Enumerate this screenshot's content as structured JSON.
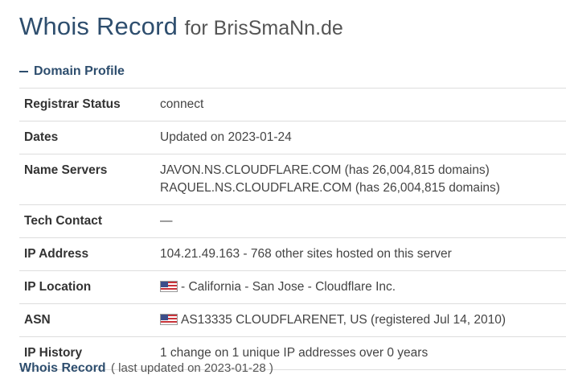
{
  "header": {
    "title": "Whois Record",
    "domain": "for BrisSmaNn.de"
  },
  "section": {
    "label": "Domain Profile",
    "icon": "minus-icon"
  },
  "profile": {
    "registrar_status": {
      "label": "Registrar Status",
      "value": "connect"
    },
    "dates": {
      "label": "Dates",
      "value": "Updated on 2023-01-24"
    },
    "name_servers": {
      "label": "Name Servers",
      "line1": "JAVON.NS.CLOUDFLARE.COM (has 26,004,815 domains)",
      "line2": "RAQUEL.NS.CLOUDFLARE.COM (has 26,004,815 domains)"
    },
    "tech_contact": {
      "label": "Tech Contact",
      "value": "—"
    },
    "ip_address": {
      "label": "IP Address",
      "value": "104.21.49.163 - 768 other sites hosted on this server"
    },
    "ip_location": {
      "label": "IP Location",
      "value": "- California - San Jose - Cloudflare Inc.",
      "icon": "us-flag-icon"
    },
    "asn": {
      "label": "ASN",
      "value": "AS13335 CLOUDFLARENET, US (registered Jul 14, 2010)",
      "icon": "us-flag-icon"
    },
    "ip_history": {
      "label": "IP History",
      "value": "1 change on 1 unique IP addresses over 0 years"
    }
  },
  "footer": {
    "title": "Whois Record",
    "note": "( last updated on 2023-01-28 )"
  },
  "colors": {
    "accent": "#2e4e6e",
    "text": "#333333",
    "border": "#dddddd"
  }
}
